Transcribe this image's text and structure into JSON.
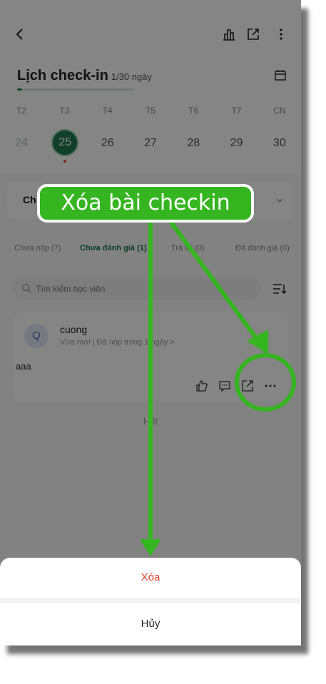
{
  "header": {
    "title": "Lịch check-in",
    "progress_text": "1/30 ngày",
    "progress": 0.033
  },
  "calendar": {
    "weekdays": [
      "T2",
      "T3",
      "T4",
      "T5",
      "T6",
      "T7",
      "CN"
    ],
    "days": [
      "24",
      "25",
      "26",
      "27",
      "28",
      "29",
      "30"
    ],
    "selected": "25"
  },
  "filter": {
    "label": "Ch"
  },
  "tabs": [
    {
      "label": "Chưa nộp (7)"
    },
    {
      "label": "Chưa đánh giá (1)"
    },
    {
      "label": "Trả lại (0)"
    },
    {
      "label": "Đã đánh giá (0)"
    }
  ],
  "search": {
    "placeholder": "Tìm kiếm học viên"
  },
  "submission": {
    "avatar_letter": "Q",
    "name": "cuong",
    "meta": "Vừa mới | Đã nộp trong 1 ngày >",
    "content": "aaa"
  },
  "list_end": "Hết",
  "action_sheet": {
    "delete_label": "Xóa",
    "cancel_label": "Hủy"
  },
  "annotation": {
    "text": "Xóa bài checkin",
    "color": "#35b51f"
  },
  "colors": {
    "accent": "#1f7a51",
    "danger": "#d9412b"
  }
}
